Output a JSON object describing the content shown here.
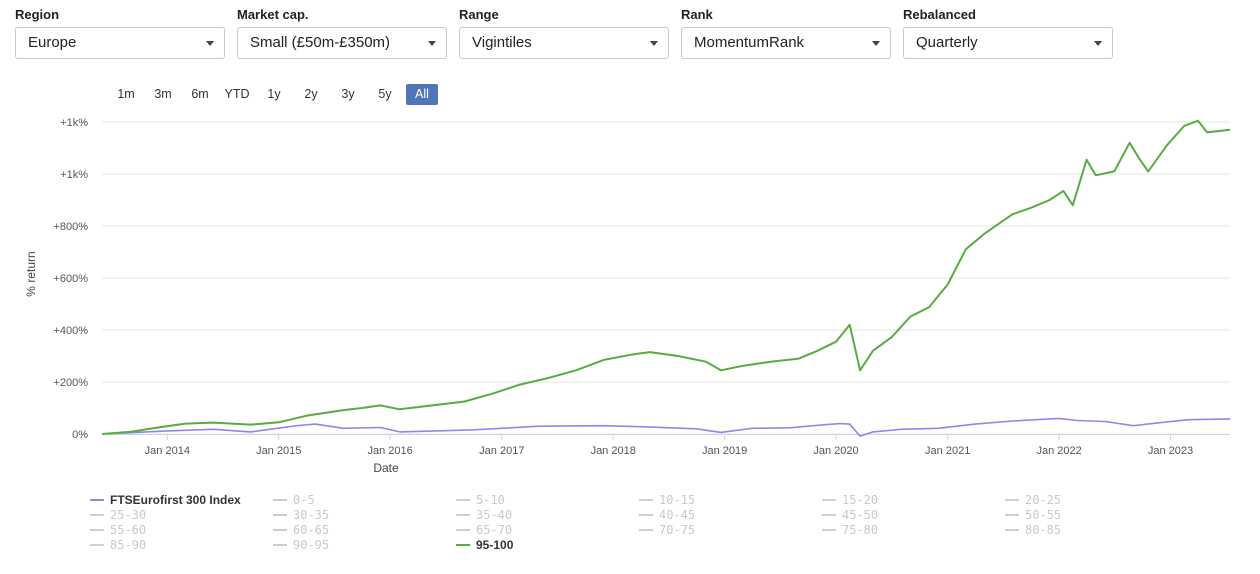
{
  "filters": [
    {
      "label": "Region",
      "value": "Europe"
    },
    {
      "label": "Market cap.",
      "value": "Small (£50m-£350m)"
    },
    {
      "label": "Range",
      "value": "Vigintiles"
    },
    {
      "label": "Rank",
      "value": "MomentumRank"
    },
    {
      "label": "Rebalanced",
      "value": "Quarterly"
    }
  ],
  "range_buttons": [
    "1m",
    "3m",
    "6m",
    "YTD",
    "1y",
    "2y",
    "3y",
    "5y",
    "All"
  ],
  "range_selected": "All",
  "colors": {
    "index": "#8a89f0",
    "top": "#58ac42",
    "inactive": "#cfcfcf",
    "grid": "#e6e6e6",
    "active_btn": "#4f77b7"
  },
  "chart_data": {
    "type": "line",
    "xlabel": "Date",
    "ylabel": "% return",
    "ylim": [
      0,
      1200
    ],
    "x_ticks": [
      "Jan 2014",
      "Jan 2015",
      "Jan 2016",
      "Jan 2017",
      "Jan 2018",
      "Jan 2019",
      "Jan 2020",
      "Jan 2021",
      "Jan 2022",
      "Jan 2023"
    ],
    "y_ticks": [
      {
        "value": 0,
        "label": "0%"
      },
      {
        "value": 200,
        "label": "+200%"
      },
      {
        "value": 400,
        "label": "+400%"
      },
      {
        "value": 600,
        "label": "+600%"
      },
      {
        "value": 800,
        "label": "+800%"
      },
      {
        "value": 1000,
        "label": "+1k%"
      },
      {
        "value": 1200,
        "label": "+1k%"
      }
    ],
    "x_range": [
      "2013-06-01",
      "2023-07-15"
    ],
    "series": [
      {
        "name": "FTSEurofirst 300 Index",
        "points": [
          [
            "2013-06-01",
            0
          ],
          [
            "2013-09-01",
            5
          ],
          [
            "2014-01-01",
            12
          ],
          [
            "2014-06-01",
            18
          ],
          [
            "2014-10-01",
            8
          ],
          [
            "2015-03-01",
            32
          ],
          [
            "2015-05-01",
            38
          ],
          [
            "2015-08-01",
            22
          ],
          [
            "2015-12-01",
            25
          ],
          [
            "2016-02-01",
            8
          ],
          [
            "2016-06-01",
            12
          ],
          [
            "2016-10-01",
            16
          ],
          [
            "2017-01-01",
            22
          ],
          [
            "2017-05-01",
            30
          ],
          [
            "2017-12-01",
            32
          ],
          [
            "2018-04-01",
            28
          ],
          [
            "2018-10-01",
            20
          ],
          [
            "2018-12-20",
            6
          ],
          [
            "2019-04-01",
            22
          ],
          [
            "2019-08-01",
            24
          ],
          [
            "2019-12-01",
            36
          ],
          [
            "2020-01-15",
            40
          ],
          [
            "2020-02-15",
            38
          ],
          [
            "2020-03-20",
            -8
          ],
          [
            "2020-05-01",
            8
          ],
          [
            "2020-08-01",
            18
          ],
          [
            "2020-12-01",
            22
          ],
          [
            "2021-04-01",
            38
          ],
          [
            "2021-08-01",
            50
          ],
          [
            "2022-01-01",
            60
          ],
          [
            "2022-03-01",
            52
          ],
          [
            "2022-06-01",
            48
          ],
          [
            "2022-09-01",
            32
          ],
          [
            "2022-12-01",
            44
          ],
          [
            "2023-03-01",
            55
          ],
          [
            "2023-07-15",
            58
          ]
        ]
      },
      {
        "name": "95-100",
        "points": [
          [
            "2013-06-01",
            0
          ],
          [
            "2013-09-01",
            8
          ],
          [
            "2013-12-01",
            25
          ],
          [
            "2014-03-01",
            40
          ],
          [
            "2014-06-01",
            44
          ],
          [
            "2014-10-01",
            36
          ],
          [
            "2015-01-01",
            45
          ],
          [
            "2015-04-01",
            70
          ],
          [
            "2015-08-01",
            92
          ],
          [
            "2015-10-01",
            100
          ],
          [
            "2015-12-01",
            110
          ],
          [
            "2016-02-01",
            95
          ],
          [
            "2016-06-01",
            112
          ],
          [
            "2016-09-01",
            125
          ],
          [
            "2016-12-01",
            155
          ],
          [
            "2017-03-01",
            190
          ],
          [
            "2017-06-01",
            215
          ],
          [
            "2017-09-01",
            245
          ],
          [
            "2017-12-01",
            285
          ],
          [
            "2018-03-01",
            305
          ],
          [
            "2018-05-01",
            315
          ],
          [
            "2018-08-01",
            300
          ],
          [
            "2018-11-01",
            278
          ],
          [
            "2018-12-20",
            245
          ],
          [
            "2019-03-01",
            262
          ],
          [
            "2019-06-01",
            278
          ],
          [
            "2019-09-01",
            290
          ],
          [
            "2019-11-01",
            320
          ],
          [
            "2020-01-01",
            355
          ],
          [
            "2020-02-15",
            420
          ],
          [
            "2020-03-20",
            245
          ],
          [
            "2020-05-01",
            320
          ],
          [
            "2020-07-01",
            372
          ],
          [
            "2020-09-01",
            452
          ],
          [
            "2020-11-01",
            488
          ],
          [
            "2021-01-01",
            575
          ],
          [
            "2021-03-01",
            710
          ],
          [
            "2021-05-01",
            770
          ],
          [
            "2021-08-01",
            845
          ],
          [
            "2021-10-01",
            870
          ],
          [
            "2021-12-01",
            900
          ],
          [
            "2022-01-15",
            935
          ],
          [
            "2022-02-15",
            880
          ],
          [
            "2022-04-01",
            1055
          ],
          [
            "2022-05-01",
            995
          ],
          [
            "2022-07-01",
            1010
          ],
          [
            "2022-08-20",
            1120
          ],
          [
            "2022-09-20",
            1060
          ],
          [
            "2022-10-20",
            1010
          ],
          [
            "2022-12-20",
            1110
          ],
          [
            "2023-02-15",
            1185
          ],
          [
            "2023-04-01",
            1205
          ],
          [
            "2023-05-01",
            1160
          ],
          [
            "2023-07-15",
            1170
          ]
        ]
      }
    ]
  },
  "legend": [
    {
      "label": "FTSEurofirst 300 Index",
      "active": true,
      "color": "#8a89f0"
    },
    {
      "label": "0-5",
      "active": false
    },
    {
      "label": "5-10",
      "active": false
    },
    {
      "label": "10-15",
      "active": false
    },
    {
      "label": "15-20",
      "active": false
    },
    {
      "label": "20-25",
      "active": false
    },
    {
      "label": "25-30",
      "active": false
    },
    {
      "label": "30-35",
      "active": false
    },
    {
      "label": "35-40",
      "active": false
    },
    {
      "label": "40-45",
      "active": false
    },
    {
      "label": "45-50",
      "active": false
    },
    {
      "label": "50-55",
      "active": false
    },
    {
      "label": "55-60",
      "active": false
    },
    {
      "label": "60-65",
      "active": false
    },
    {
      "label": "65-70",
      "active": false
    },
    {
      "label": "70-75",
      "active": false
    },
    {
      "label": "75-80",
      "active": false
    },
    {
      "label": "80-85",
      "active": false
    },
    {
      "label": "85-90",
      "active": false
    },
    {
      "label": "90-95",
      "active": false
    },
    {
      "label": "95-100",
      "active": true,
      "color": "#58ac42"
    }
  ]
}
